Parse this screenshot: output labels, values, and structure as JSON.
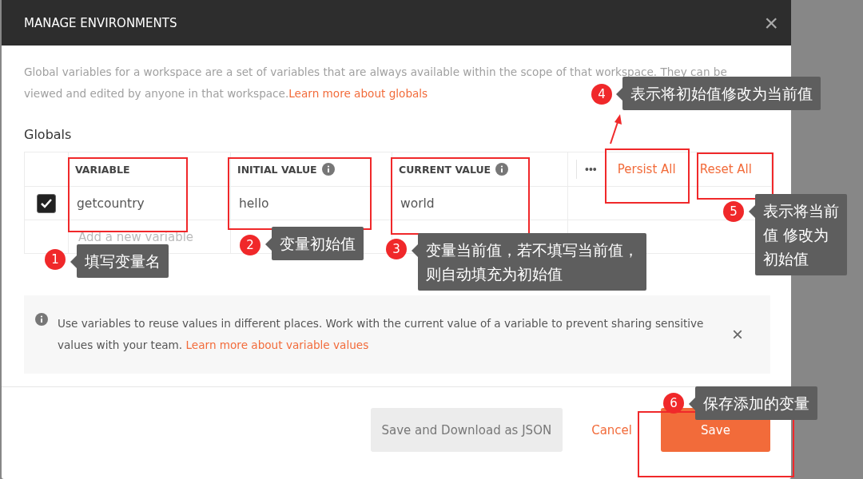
{
  "window": {
    "title": "MANAGE ENVIRONMENTS",
    "close": "×"
  },
  "intro": {
    "text": "Global variables for a workspace are a set of variables that are always available within the scope of that workspace. They can be viewed and edited by anyone in that workspace.",
    "link": "Learn more about globals"
  },
  "section_title": "Globals",
  "table": {
    "columns": [
      {
        "label": "VARIABLE",
        "info": false
      },
      {
        "label": "INITIAL VALUE",
        "info": true
      },
      {
        "label": "CURRENT VALUE",
        "info": true
      }
    ],
    "more": "•••",
    "actions": [
      "Persist All",
      "Reset All"
    ],
    "rows": [
      {
        "checked": true,
        "cells": [
          "getcountry",
          "hello",
          "world"
        ]
      }
    ],
    "new_row": {
      "placeholder": "Add a new variable"
    }
  },
  "notice": {
    "text": "Use variables to reuse values in different places. Work with the current value of a variable to prevent sharing sensitive values with your team.",
    "link": "Learn more about variable values",
    "close": "×"
  },
  "buttons": [
    {
      "label": "Save and Download as JSON",
      "kind": "secondary"
    },
    {
      "label": "Cancel",
      "kind": "link"
    },
    {
      "label": "Save",
      "kind": "primary"
    }
  ],
  "annotations": [
    {
      "number": "1",
      "lines": [
        "填写变量名"
      ]
    },
    {
      "number": "2",
      "lines": [
        "变量初始值"
      ]
    },
    {
      "number": "3",
      "lines": [
        "变量当前值，若不填写当前值，",
        "则自动填充为初始值"
      ]
    },
    {
      "number": "4",
      "lines": [
        "表示将初始值修改为当前值"
      ]
    },
    {
      "number": "5",
      "lines": [
        "表示将当前",
        "值 修改为",
        "初始值"
      ]
    },
    {
      "number": "6",
      "lines": [
        "保存添加的变量"
      ]
    }
  ]
}
